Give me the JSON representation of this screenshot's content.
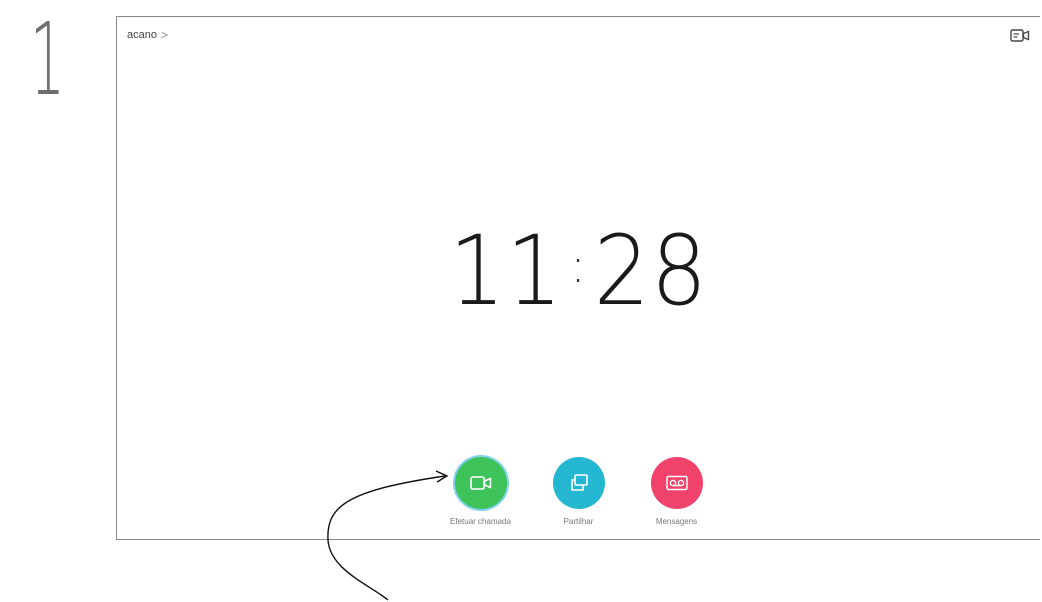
{
  "step_number": "1",
  "breadcrumb": {
    "label": "acano",
    "chevron": ">"
  },
  "clock": {
    "hours": "11",
    "separator": ":",
    "minutes": "28"
  },
  "actions": [
    {
      "label": "Efetuar chamada",
      "color": "#3ec35a",
      "icon": "video-camera-icon",
      "highlighted": true
    },
    {
      "label": "Partilhar",
      "color": "#25b6d2",
      "icon": "share-screens-icon"
    },
    {
      "label": "Mensagens",
      "color": "#f0426b",
      "icon": "voicemail-icon"
    }
  ],
  "colors": {
    "border": "#8a8a8a",
    "highlight_ring": "#7fd1ec"
  }
}
